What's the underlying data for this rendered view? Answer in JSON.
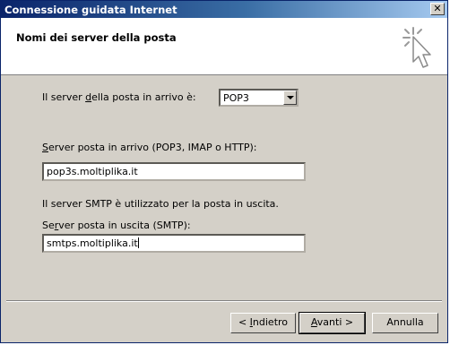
{
  "window": {
    "title": "Connessione guidata Internet",
    "close_label": "✕"
  },
  "header": {
    "title": "Nomi dei server della posta"
  },
  "incoming_type": {
    "label_pre": "Il server ",
    "label_accel": "d",
    "label_post": "ella posta in arrivo è:",
    "selected": "POP3"
  },
  "incoming_server": {
    "label_accel": "S",
    "label_post": "erver posta in arrivo (POP3, IMAP o HTTP):",
    "value": "pop3s.moltiplika.it"
  },
  "smtp_note": "Il server SMTP è utilizzato per la posta in uscita.",
  "outgoing_server": {
    "label_pre": "Se",
    "label_accel": "r",
    "label_post": "ver posta in uscita (SMTP):",
    "value": "smtps.moltiplika.it"
  },
  "buttons": {
    "back_pre": "< ",
    "back_accel": "I",
    "back_post": "ndietro",
    "next_accel": "A",
    "next_post": "vanti >",
    "cancel": "Annulla"
  }
}
